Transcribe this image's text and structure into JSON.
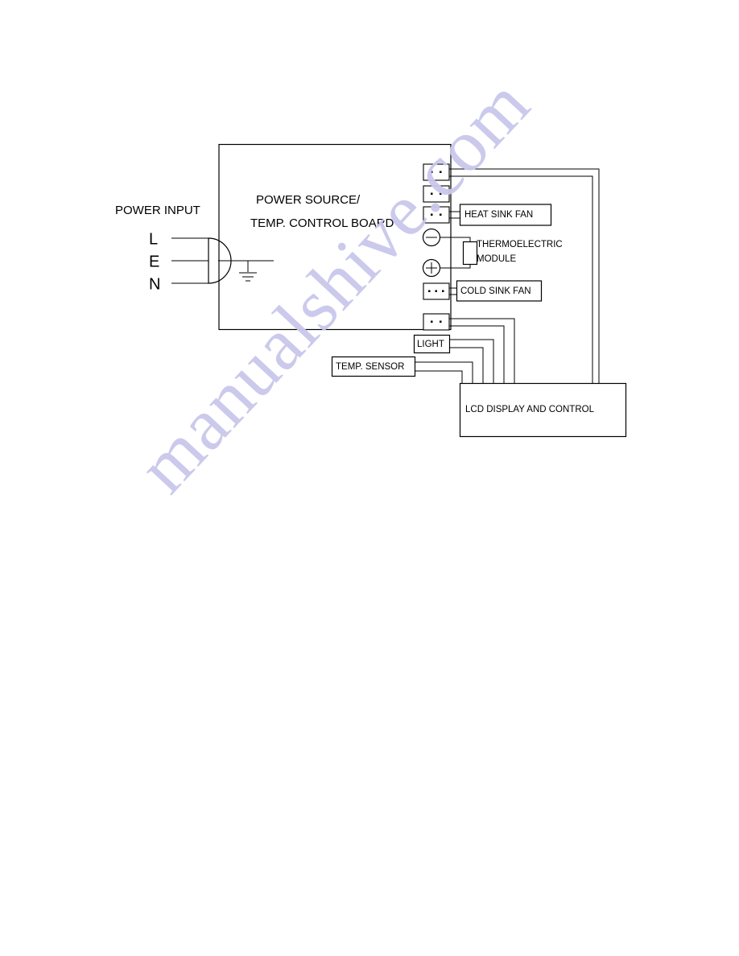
{
  "document": {
    "type": "block-diagram",
    "title": "Power Source / Temperature Control Board Wiring Block Diagram",
    "background_color": "#ffffff",
    "line_color": "#000000"
  },
  "watermark": {
    "text": "manualshive.com",
    "color": "#c9c8ec",
    "rotation_deg": -47
  },
  "power_input": {
    "label": "POWER INPUT",
    "terminals": [
      {
        "label": "L",
        "name": "line"
      },
      {
        "label": "E",
        "name": "earth"
      },
      {
        "label": "N",
        "name": "neutral"
      }
    ],
    "ground_symbol": "earth-ground"
  },
  "main_board": {
    "title_line_1": "POWER SOURCE/",
    "title_line_2": "TEMP. CONTROL BOARD"
  },
  "connectors": [
    {
      "id": "conn-1",
      "pins": 2,
      "connects_to": "lcd-display-and-control"
    },
    {
      "id": "conn-2",
      "pins": 2,
      "connects_to": ""
    },
    {
      "id": "conn-3",
      "pins": 2,
      "connects_to": "heat-sink-fan"
    },
    {
      "id": "conn-4",
      "pins": 3,
      "connects_to": "cold-sink-fan"
    },
    {
      "id": "conn-5",
      "pins": 2,
      "connects_to": "lcd-display-and-control"
    }
  ],
  "terminals": [
    {
      "id": "terminal-negative",
      "symbol": "−",
      "label": "negative"
    },
    {
      "id": "terminal-positive",
      "symbol": "+",
      "label": "positive"
    }
  ],
  "components": [
    {
      "id": "heat-sink-fan",
      "label": "HEAT SINK FAN"
    },
    {
      "id": "thermoelectric-module",
      "label_line_1": "THERMOELECTRIC",
      "label_line_2": "MODULE"
    },
    {
      "id": "cold-sink-fan",
      "label": "COLD SINK FAN"
    },
    {
      "id": "light",
      "label": "LIGHT"
    },
    {
      "id": "temp-sensor",
      "label": "TEMP. SENSOR"
    },
    {
      "id": "lcd-display",
      "label": "LCD DISPLAY AND CONTROL"
    }
  ]
}
